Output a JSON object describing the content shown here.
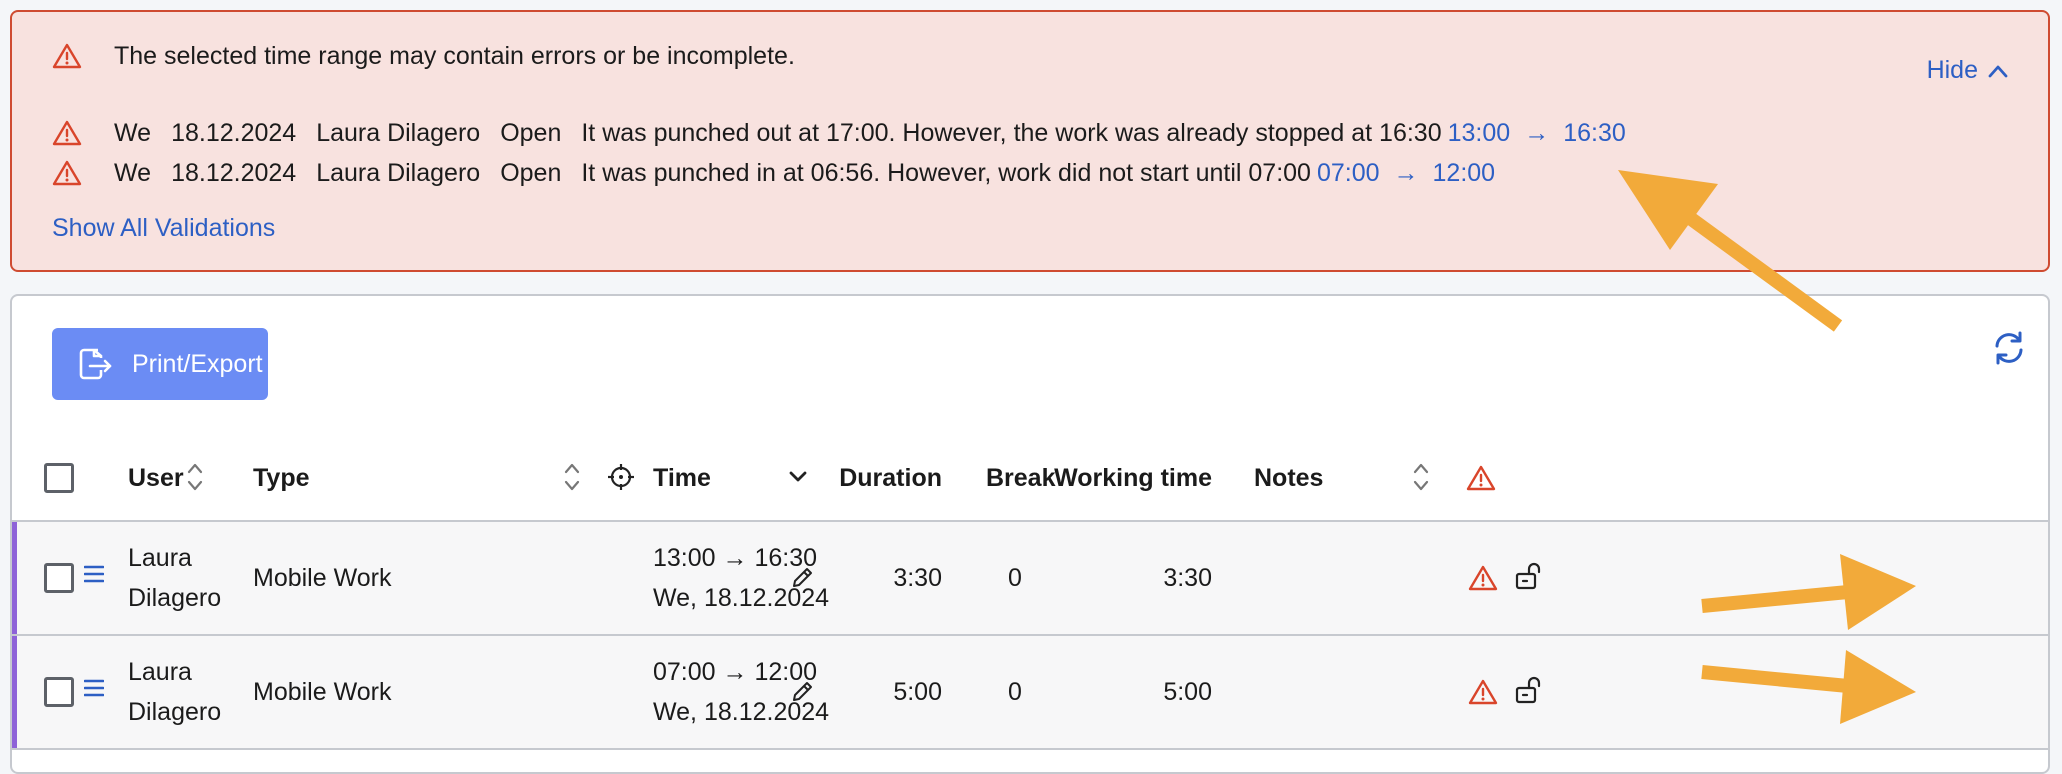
{
  "alert": {
    "message": "The selected time range may contain errors or be incomplete.",
    "hide_label": "Hide",
    "show_all_label": "Show All Validations",
    "validations": [
      {
        "day": "We",
        "date": "18.12.2024",
        "user": "Laura Dilagero",
        "status": "Open",
        "message": "It was punched out at 17:00. However, the work was already stopped at 16:30",
        "start": "13:00",
        "arrow": "→",
        "end": "16:30"
      },
      {
        "day": "We",
        "date": "18.12.2024",
        "user": "Laura Dilagero",
        "status": "Open",
        "message": "It was punched in at 06:56. However, work did not start until 07:00",
        "start": "07:00",
        "arrow": "→",
        "end": "12:00"
      }
    ]
  },
  "toolbar": {
    "export_label": "Print/Export",
    "export_icon": "export-icon",
    "refresh_icon": "refresh-icon"
  },
  "table": {
    "columns": {
      "user": "User",
      "type": "Type",
      "time": "Time",
      "duration": "Duration",
      "break": "Break",
      "working_time": "Working time",
      "notes": "Notes"
    },
    "rows": [
      {
        "user_first": "Laura",
        "user_last": "Dilagero",
        "type": "Mobile Work",
        "time_range": "13:00 → 16:30",
        "time_date": "We, 18.12.2024",
        "duration": "3:30",
        "break": "0",
        "working_time": "3:30",
        "notes": ""
      },
      {
        "user_first": "Laura",
        "user_last": "Dilagero",
        "type": "Mobile Work",
        "time_range": "07:00 → 12:00",
        "time_date": "We, 18.12.2024",
        "duration": "5:00",
        "break": "0",
        "working_time": "5:00",
        "notes": ""
      }
    ]
  },
  "colors": {
    "alert_bg": "#f8e2df",
    "alert_border": "#cf4b31",
    "link": "#2d5fc4",
    "primary_button": "#6b8cf4",
    "warning": "#d9452b",
    "row_accent": "#8e63d8",
    "annotation_arrow": "#f2aa3a"
  }
}
